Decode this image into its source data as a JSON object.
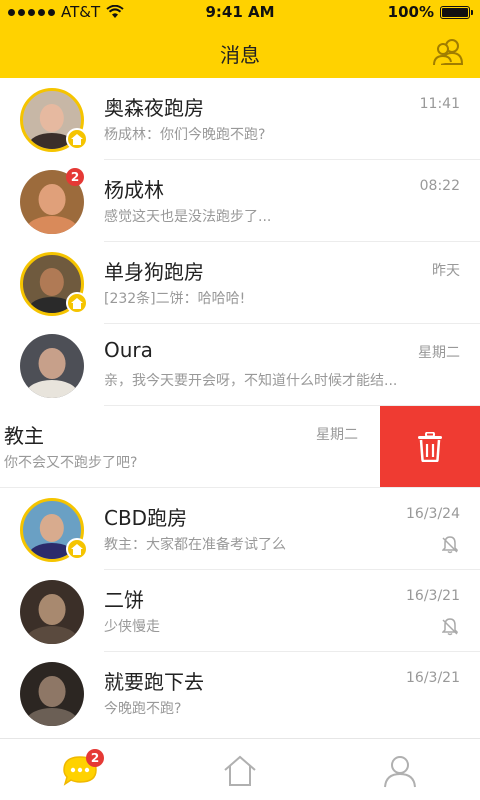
{
  "status_bar": {
    "carrier": "AT&T",
    "time": "9:41 AM",
    "battery": "100%"
  },
  "nav": {
    "title": "消息",
    "right_icon": "friends-icon"
  },
  "colors": {
    "brand_yellow": "#ffd200",
    "delete_red": "#ef3b32",
    "badge_red": "#e53935"
  },
  "conversations": [
    {
      "name": "奥森夜跑房",
      "preview": "杨成林：你们今晚跑不跑?",
      "time": "11:41",
      "group": true
    },
    {
      "name": "杨成林",
      "preview": "感觉这天也是没法跑步了...",
      "time": "08:22",
      "unread": "2"
    },
    {
      "name": "单身狗跑房",
      "preview": "[232条]二饼：哈哈哈!",
      "time": "昨天",
      "group": true
    },
    {
      "name": "Oura",
      "preview": "亲，我今天要开会呀，不知道什么时候才能结...",
      "time": "星期二"
    },
    {
      "name": "教主",
      "preview": "你不会又不跑步了吧?",
      "time": "星期二",
      "swiped": true,
      "action": "delete-icon"
    },
    {
      "name": "CBD跑房",
      "preview": "教主：大家都在准备考试了么",
      "time": "16/3/24",
      "group": true,
      "muted": true
    },
    {
      "name": "二饼",
      "preview": "少侠慢走",
      "time": "16/3/21",
      "muted": true
    },
    {
      "name": "就要跑下去",
      "preview": "今晚跑不跑?",
      "time": "16/3/21"
    }
  ],
  "tab_bar": {
    "tabs": [
      "message-icon",
      "home-icon",
      "profile-icon"
    ],
    "message_badge": "2"
  }
}
